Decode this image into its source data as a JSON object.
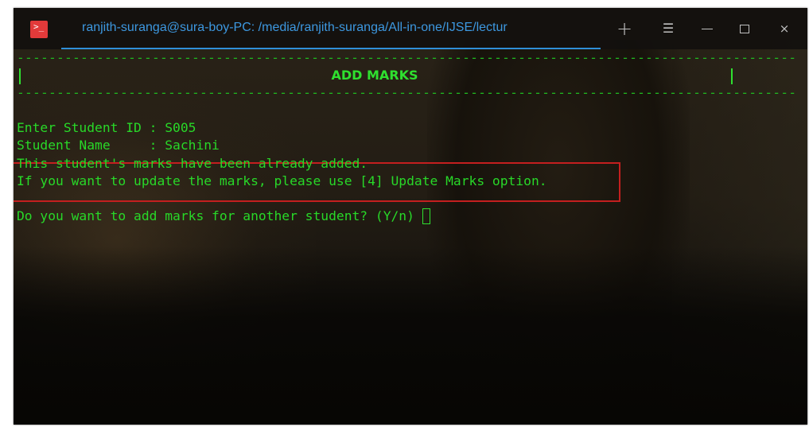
{
  "window": {
    "title": "ranjith-suranga@sura-boy-PC: /media/ranjith-suranga/All-in-one/IJSE/lectur",
    "icon": "terminal-icon",
    "buttons": {
      "new_tab": "+",
      "menu": "☰",
      "close": "×"
    }
  },
  "terminal": {
    "divider": "--------------------------------------------------------------------------------------------------",
    "header": "ADD MARKS",
    "student_id_line": "Enter Student ID : S005",
    "student_name_line": "Student Name     : Sachini",
    "warning_line1": "This student's marks have been already added.",
    "warning_line2": "If you want to update the marks, please use [4] Update Marks option.",
    "prompt": "Do you want to add marks for another student? (Y/n) "
  },
  "colors": {
    "terminal_text": "#28d828",
    "tab_accent": "#2f8fd8",
    "highlight_border": "#c41f1f",
    "app_icon": "#e23a3a"
  }
}
